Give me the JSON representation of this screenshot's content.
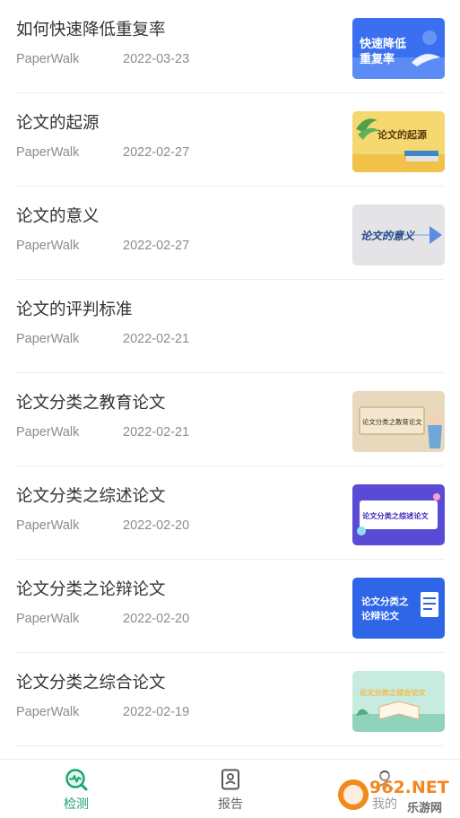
{
  "articles": [
    {
      "title": "如何快速降低重复率",
      "author": "PaperWalk",
      "date": "2022-03-23",
      "thumb": {
        "text_line1": "快速降低",
        "text_line2": "重复率",
        "bg": "#3a6ff0"
      }
    },
    {
      "title": "论文的起源",
      "author": "PaperWalk",
      "date": "2022-02-27",
      "thumb": {
        "text": "论文的起源",
        "bg": "#f5d870"
      }
    },
    {
      "title": "论文的意义",
      "author": "PaperWalk",
      "date": "2022-02-27",
      "thumb": {
        "text": "论文的意义",
        "bg": "#e4e4e6"
      }
    },
    {
      "title": "论文的评判标准",
      "author": "PaperWalk",
      "date": "2022-02-21"
    },
    {
      "title": "论文分类之教育论文",
      "author": "PaperWalk",
      "date": "2022-02-21",
      "thumb": {
        "text": "论文分类之教育论文",
        "bg": "#e8d9bd"
      }
    },
    {
      "title": "论文分类之综述论文",
      "author": "PaperWalk",
      "date": "2022-02-20",
      "thumb": {
        "text": "论文分类之综述论文",
        "bg": "#5a4bd6"
      }
    },
    {
      "title": "论文分类之论辩论文",
      "author": "PaperWalk",
      "date": "2022-02-20",
      "thumb": {
        "text_line1": "论文分类之",
        "text_line2": "论辩论文",
        "bg": "#2f66e8"
      }
    },
    {
      "title": "论文分类之综合论文",
      "author": "PaperWalk",
      "date": "2022-02-19",
      "thumb": {
        "text": "论文分类之综合论文",
        "bg": "#c8ebe0"
      }
    }
  ],
  "tabbar": {
    "tabs": [
      {
        "label": "检测",
        "icon": "detect-icon",
        "active": true
      },
      {
        "label": "报告",
        "icon": "report-icon",
        "active": false
      },
      {
        "label": "我的",
        "icon": "profile-icon",
        "active": false
      }
    ],
    "active_color": "#1aa36b",
    "inactive_color": "#666666"
  },
  "watermark": {
    "text_top": "962.NET",
    "text_bottom": "乐游网"
  }
}
